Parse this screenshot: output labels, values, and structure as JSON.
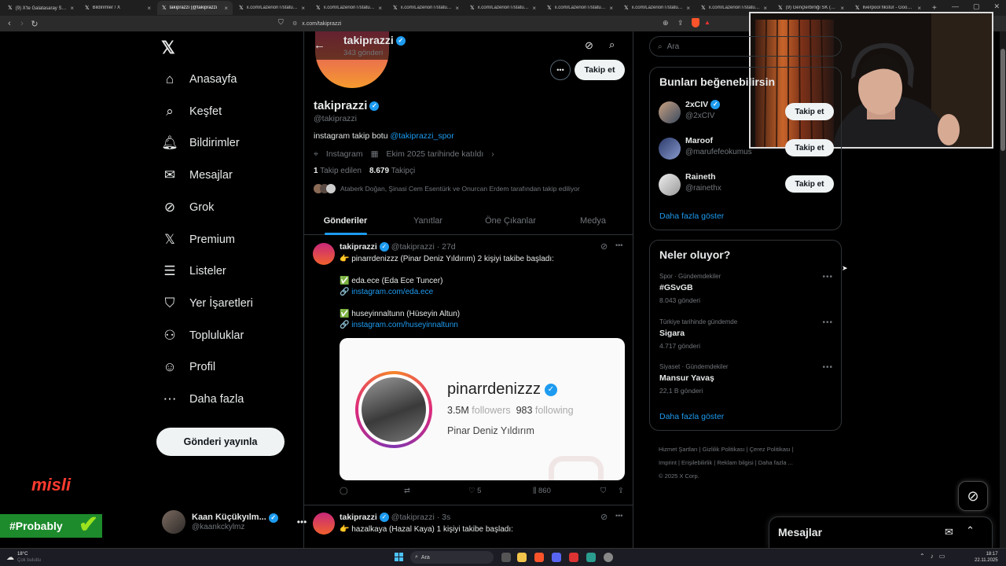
{
  "browser": {
    "tabs": [
      {
        "title": "(9) X'te Galatasaray SK: \"🇲🇽",
        "active": false
      },
      {
        "title": "Bildirimler / X",
        "active": false
      },
      {
        "title": "takiprazzi (@takiprazzi",
        "active": true
      },
      {
        "title": "x.com/LazerionT/status/19(",
        "active": false
      },
      {
        "title": "x.com/LazerionT/status/19(",
        "active": false
      },
      {
        "title": "x.com/LazerionT/status/19(",
        "active": false
      },
      {
        "title": "x.com/LazerionT/status/19(",
        "active": false
      },
      {
        "title": "x.com/LazerionT/status/19(",
        "active": false
      },
      {
        "title": "x.com/LazerionT/status/19(",
        "active": false
      },
      {
        "title": "x.com/LazerionT/status/19(",
        "active": false
      },
      {
        "title": "(9) Gençlerbirliği SK (@krm",
        "active": false
      },
      {
        "title": "liverpool fikstür - Google'da",
        "active": false
      }
    ],
    "url": "x.com/takiprazzi"
  },
  "left_nav": {
    "items": [
      {
        "label": "Anasayfa",
        "icon": "home-icon"
      },
      {
        "label": "Keşfet",
        "icon": "search-icon"
      },
      {
        "label": "Bildirimler",
        "icon": "bell-icon"
      },
      {
        "label": "Mesajlar",
        "icon": "envelope-icon"
      },
      {
        "label": "Grok",
        "icon": "grok-icon"
      },
      {
        "label": "Premium",
        "icon": "x-icon"
      },
      {
        "label": "Listeler",
        "icon": "list-icon"
      },
      {
        "label": "Yer İşaretleri",
        "icon": "bookmark-icon"
      },
      {
        "label": "Topluluklar",
        "icon": "communities-icon"
      },
      {
        "label": "Profil",
        "icon": "person-icon"
      },
      {
        "label": "Daha fazla",
        "icon": "more-circle-icon"
      }
    ],
    "post_button": "Gönderi yayınla",
    "account": {
      "name": "Kaan Küçükyılm...",
      "handle": "@kaankckylmz"
    }
  },
  "overlay": {
    "sponsor": "misli",
    "banner": "#Probably"
  },
  "profile": {
    "header_name": "takiprazzi",
    "header_posts": "343 gönderi",
    "name": "takiprazzi",
    "handle": "@takiprazzi",
    "bio_text": "instagram takip botu",
    "bio_link": "@takiprazzi_spor",
    "location": "Instagram",
    "joined": "Ekim 2025 tarihinde katıldı",
    "following_count": "1",
    "following_label": "Takip edilen",
    "followers_count": "8.679",
    "followers_label": "Takipçi",
    "followed_by": "Ataberk Doğan, Şinasi Cem Esentürk ve Onurcan Erdem tarafından takip ediliyor",
    "follow_button": "Takip et",
    "tabs": [
      "Gönderiler",
      "Yanıtlar",
      "Öne Çıkanlar",
      "Medya"
    ]
  },
  "tweets": [
    {
      "name": "takiprazzi",
      "handle": "@takiprazzi",
      "time": "· 27d",
      "line1": "👉 pinarrdenizzz (Pinar Deniz Yıldırım) 2 kişiyi takibe başladı:",
      "line2": "✅ eda.ece (Eda Ece Tuncer)",
      "line3_link": "instagram.com/eda.ece",
      "line4": "✅ huseyinnaltunn (Hüseyin Altun)",
      "line5_link": "instagram.com/huseyinnaltunn",
      "card": {
        "username": "pinarrdenizzz",
        "followers_num": "3.5M",
        "followers_label": "followers",
        "following_num": "983",
        "following_label": "following",
        "full_name": "Pinar Deniz Yıldırım"
      },
      "likes": "5",
      "views": "860"
    },
    {
      "name": "takiprazzi",
      "handle": "@takiprazzi",
      "time": "· 3s",
      "line1": "👉 hazalkaya (Hazal Kaya) 1 kişiyi takibe başladı:"
    }
  ],
  "right": {
    "search_placeholder": "Ara",
    "who_to_follow": {
      "title": "Bunları beğenebilirsin",
      "users": [
        {
          "name": "2xCIV",
          "handle": "@2xCIV"
        },
        {
          "name": "Maroof",
          "handle": "@marufefeokumus"
        },
        {
          "name": "Raineth",
          "handle": "@rainethx"
        }
      ],
      "follow_label": "Takip et",
      "show_more": "Daha fazla göster"
    },
    "trends": {
      "title": "Neler oluyor?",
      "items": [
        {
          "context": "Spor · Gündemdekiler",
          "name": "#GSvGB",
          "count": "8.043 gönderi"
        },
        {
          "context": "Türkiye tarihinde gündemde",
          "name": "Sigara",
          "count": "4.717 gönderi"
        },
        {
          "context": "Siyaset · Gündemdekiler",
          "name": "Mansur Yavaş",
          "count": "22,1 B gönderi"
        }
      ],
      "show_more": "Daha fazla göster"
    },
    "footer": {
      "line1": [
        "Hizmet Şartları",
        "Gizlilik Politikası",
        "Çerez Politikası"
      ],
      "line2": [
        "Imprint",
        "Erişilebilirlik",
        "Reklam bilgisi",
        "Daha fazla ..."
      ],
      "copyright": "© 2025 X Corp."
    },
    "messages_drawer": "Mesajlar"
  },
  "taskbar": {
    "weather_temp": "18°C",
    "weather_desc": "Çok bulutlu",
    "search": "Ara",
    "time": "18:17",
    "date": "22.11.2025"
  }
}
